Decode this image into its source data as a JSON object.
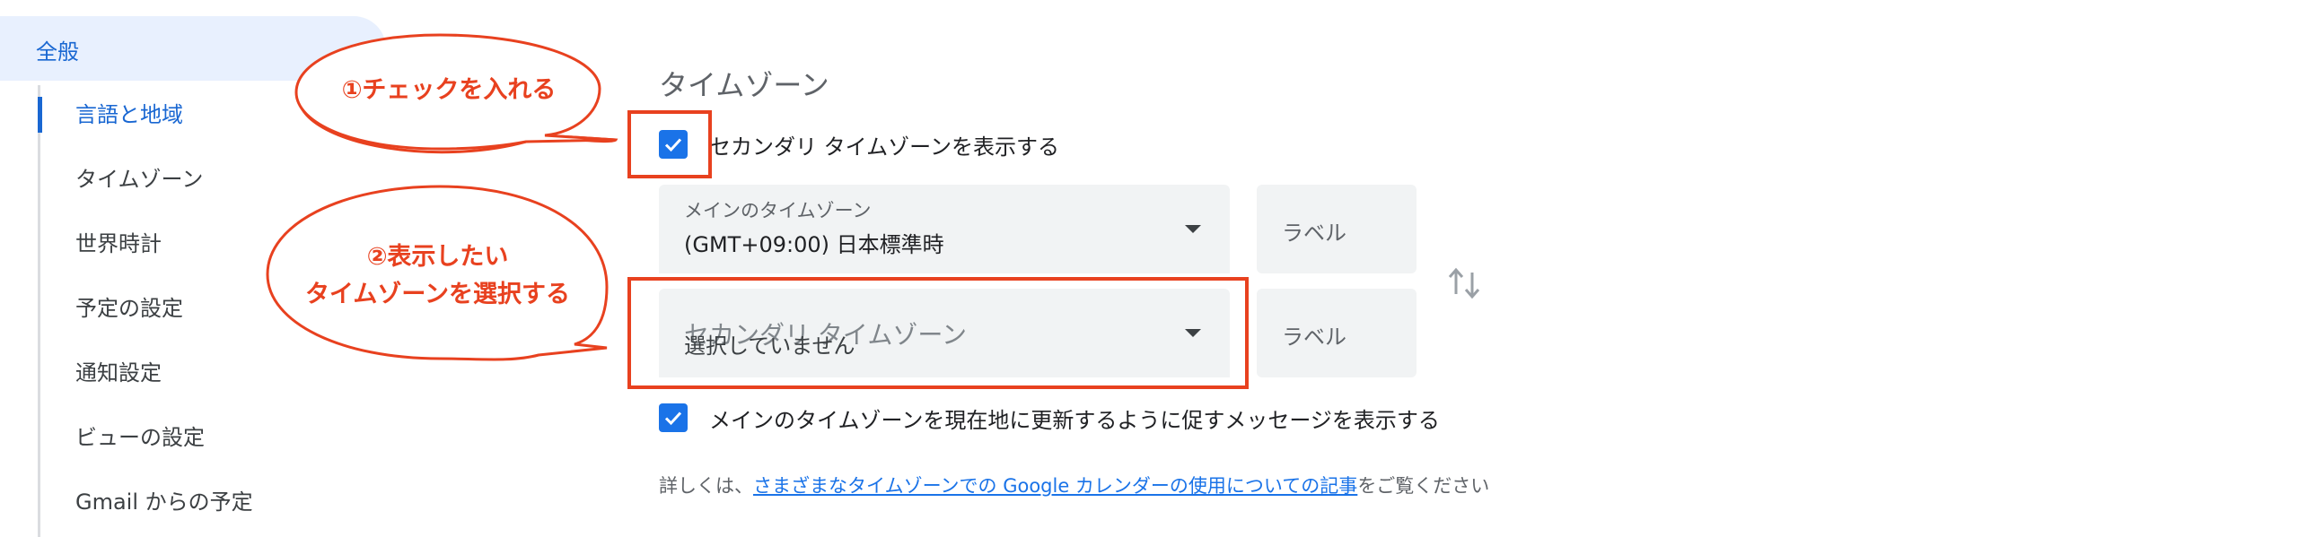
{
  "sidebar": {
    "general": "全般",
    "items": [
      {
        "label": "言語と地域"
      },
      {
        "label": "タイムゾーン"
      },
      {
        "label": "世界時計"
      },
      {
        "label": "予定の設定"
      },
      {
        "label": "通知設定"
      },
      {
        "label": "ビューの設定"
      },
      {
        "label": "Gmail からの予定"
      }
    ]
  },
  "main": {
    "section_title": "タイムゾーン",
    "secondary_checkbox_label": "セカンダリ タイムゾーンを表示する",
    "primary_select": {
      "label": "メインのタイムゾーン",
      "value": "(GMT+09:00) 日本標準時"
    },
    "secondary_select": {
      "label": "セカンダリ タイムゾーン",
      "value": "選択していません"
    },
    "label_placeholder": "ラベル",
    "update_checkbox_label": "メインのタイムゾーンを現在地に更新するように促すメッセージを表示する",
    "info_prefix": "詳しくは、",
    "info_link": "さまざまなタイムゾーンでの Google カレンダーの使用についての記事",
    "info_suffix": "をご覧ください"
  },
  "annotations": {
    "step1": "①チェックを入れる",
    "step2_line1": "②表示したい",
    "step2_line2": "タイムゾーンを選択する",
    "color": "#e8411f"
  },
  "colors": {
    "accent": "#1a73e8",
    "active_nav_bg": "#e8f0fe",
    "field_bg": "#f1f3f4"
  }
}
